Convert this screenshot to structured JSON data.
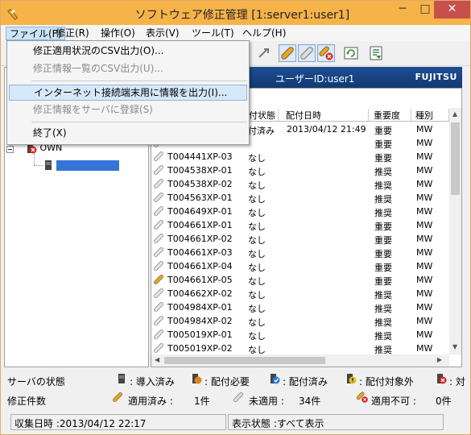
{
  "window": {
    "title": "ソフトウェア修正管理 [1:server1:user1]",
    "minimize": "─",
    "maximize": "□",
    "close": "✕"
  },
  "menubar": {
    "items": [
      {
        "label": "ファイル(F)"
      },
      {
        "label": "修正(R)"
      },
      {
        "label": "操作(O)"
      },
      {
        "label": "表示(V)"
      },
      {
        "label": "ツール(T)"
      },
      {
        "label": "ヘルプ(H)"
      }
    ]
  },
  "file_menu": {
    "items": [
      {
        "label": "修正適用状況のCSV出力(O)...",
        "enabled": true
      },
      {
        "label": "修正情報一覧のCSV出力(U)...",
        "enabled": false
      },
      {
        "label": "インターネット接続端末用に情報を出力(I)...",
        "enabled": true
      },
      {
        "label": "修正情報をサーバに登録(S)",
        "enabled": false
      },
      {
        "label": "終了(X)",
        "enabled": true
      }
    ]
  },
  "banner": {
    "user_label": "ユーザーID:user1",
    "brand": "FUJITSU"
  },
  "tree": {
    "own_label": "OWN",
    "server_label": ""
  },
  "grid": {
    "headers": [
      "付状態",
      "配付日時",
      "重要度",
      "種別"
    ],
    "rows": [
      {
        "id": "",
        "status": "付済み",
        "date": "2013/04/12 21:49",
        "importance": "重要",
        "type": "MW",
        "icon": "applied"
      },
      {
        "id": "",
        "status": "",
        "date": "",
        "importance": "重要",
        "type": "MW",
        "icon": "unapplied"
      },
      {
        "id": "T004441XP-03",
        "status": "なし",
        "date": "",
        "importance": "重要",
        "type": "MW",
        "icon": "unapplied"
      },
      {
        "id": "T004538XP-01",
        "status": "なし",
        "date": "",
        "importance": "推奨",
        "type": "MW",
        "icon": "unapplied"
      },
      {
        "id": "T004538XP-02",
        "status": "なし",
        "date": "",
        "importance": "推奨",
        "type": "MW",
        "icon": "unapplied"
      },
      {
        "id": "T004563XP-01",
        "status": "なし",
        "date": "",
        "importance": "推奨",
        "type": "MW",
        "icon": "unapplied"
      },
      {
        "id": "T004649XP-01",
        "status": "なし",
        "date": "",
        "importance": "推奨",
        "type": "MW",
        "icon": "unapplied"
      },
      {
        "id": "T004661XP-01",
        "status": "なし",
        "date": "",
        "importance": "重要",
        "type": "MW",
        "icon": "unapplied"
      },
      {
        "id": "T004661XP-02",
        "status": "なし",
        "date": "",
        "importance": "重要",
        "type": "MW",
        "icon": "unapplied"
      },
      {
        "id": "T004661XP-03",
        "status": "なし",
        "date": "",
        "importance": "重要",
        "type": "MW",
        "icon": "unapplied"
      },
      {
        "id": "T004661XP-04",
        "status": "なし",
        "date": "",
        "importance": "重要",
        "type": "MW",
        "icon": "unapplied"
      },
      {
        "id": "T004661XP-05",
        "status": "なし",
        "date": "",
        "importance": "重要",
        "type": "MW",
        "icon": "applied"
      },
      {
        "id": "T004662XP-02",
        "status": "なし",
        "date": "",
        "importance": "推奨",
        "type": "MW",
        "icon": "unapplied"
      },
      {
        "id": "T004984XP-01",
        "status": "なし",
        "date": "",
        "importance": "推奨",
        "type": "MW",
        "icon": "unapplied"
      },
      {
        "id": "T004984XP-02",
        "status": "なし",
        "date": "",
        "importance": "推奨",
        "type": "MW",
        "icon": "unapplied"
      },
      {
        "id": "T005019XP-01",
        "status": "なし",
        "date": "",
        "importance": "推奨",
        "type": "MW",
        "icon": "unapplied"
      },
      {
        "id": "T005019XP-02",
        "status": "なし",
        "date": "",
        "importance": "推奨",
        "type": "MW",
        "icon": "unapplied"
      }
    ]
  },
  "server_status": {
    "label": "サーバの状態",
    "legend": [
      {
        "label": ": 導入済み",
        "icon": "installed-icon"
      },
      {
        "label": ": 配付必要",
        "icon": "distribution-needed-icon"
      },
      {
        "label": ": 配付済み",
        "icon": "distributed-icon"
      },
      {
        "label": ": 配付対象外",
        "icon": "not-target-icon"
      },
      {
        "label": ": 対",
        "icon": "error-icon"
      }
    ]
  },
  "fix_count": {
    "label": "修正件数",
    "applied_label": "適用済み :",
    "applied_count": "1件",
    "unapplied_label": "未適用 :",
    "unapplied_count": "34件",
    "not_applicable_label": "適用不可 :",
    "not_applicable_count": "0件"
  },
  "statusbar": {
    "collected": "収集日時 :2013/04/12 22:17",
    "display_state": "表示状態 :すべて表示"
  },
  "colors": {
    "titlebar": "#f6b34a",
    "banner": "#1d4e94",
    "close_button": "#c7504a"
  }
}
